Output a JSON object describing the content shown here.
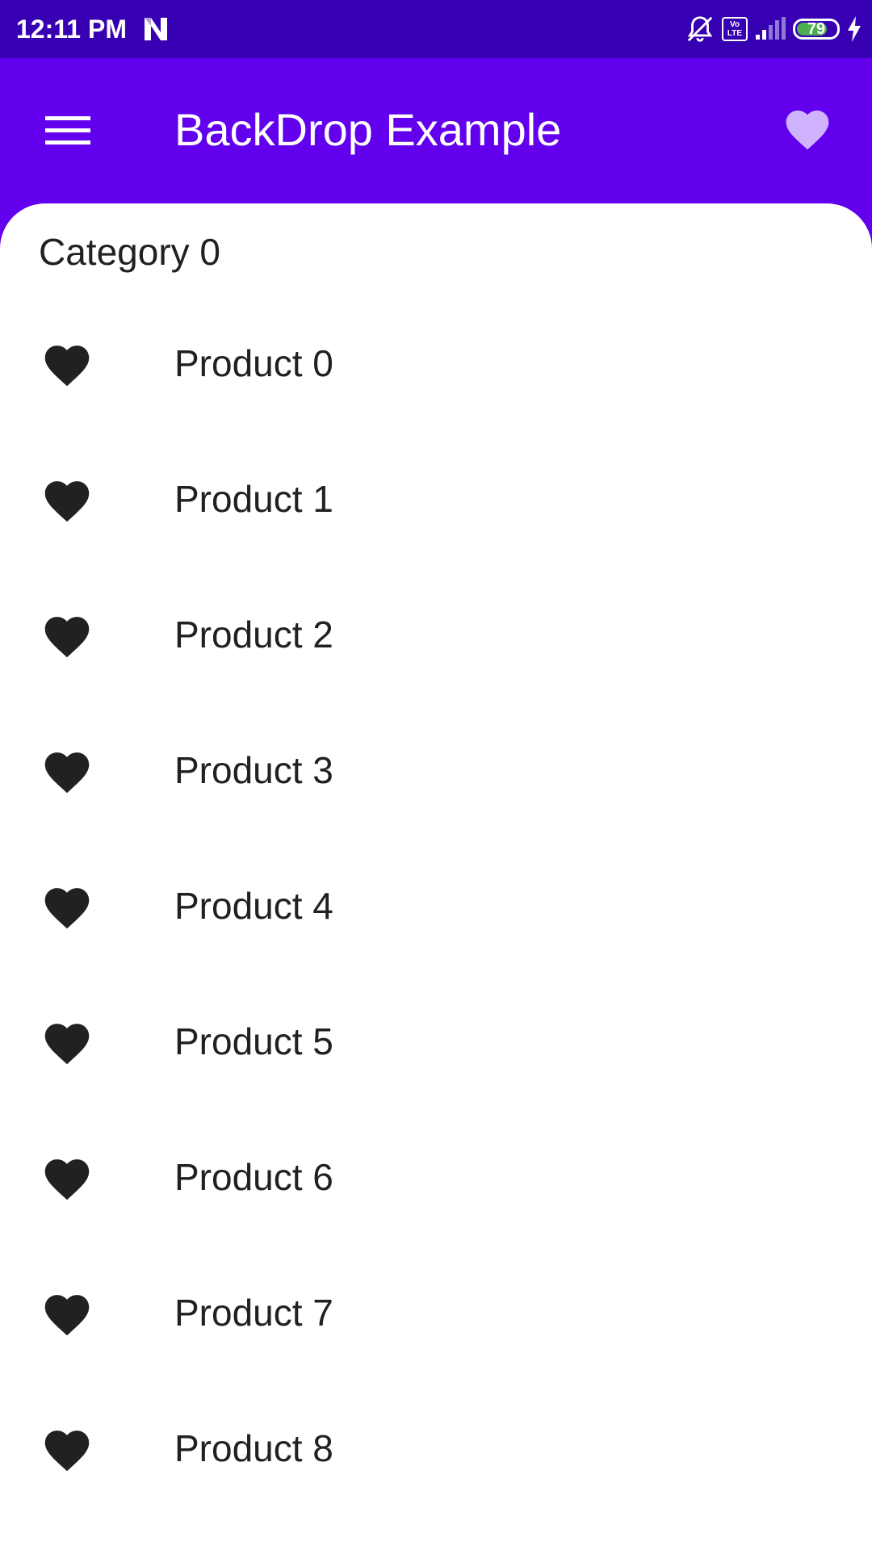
{
  "status_bar": {
    "time": "12:11 PM",
    "battery": "79",
    "battery_level_percent": 79,
    "volte": {
      "top": "Vo",
      "bottom": "LTE"
    },
    "icons": [
      "n-notification-icon",
      "alarm-off-icon",
      "volte-icon",
      "signal-icon",
      "battery-icon",
      "charging-icon"
    ]
  },
  "app_bar": {
    "title": "BackDrop Example",
    "menu_icon": "menu-icon",
    "favorite_icon": "heart-icon"
  },
  "category": "Category 0",
  "products": [
    {
      "label": "Product 0",
      "icon": "heart-icon"
    },
    {
      "label": "Product 1",
      "icon": "heart-icon"
    },
    {
      "label": "Product 2",
      "icon": "heart-icon"
    },
    {
      "label": "Product 3",
      "icon": "heart-icon"
    },
    {
      "label": "Product 4",
      "icon": "heart-icon"
    },
    {
      "label": "Product 5",
      "icon": "heart-icon"
    },
    {
      "label": "Product 6",
      "icon": "heart-icon"
    },
    {
      "label": "Product 7",
      "icon": "heart-icon"
    },
    {
      "label": "Product 8",
      "icon": "heart-icon"
    }
  ],
  "colors": {
    "primary": "#6200EE",
    "status_bar": "#3700B3",
    "app_bar_heart": "#D0B3FF",
    "list_icon": "#212121",
    "battery": "#4CAF50"
  }
}
